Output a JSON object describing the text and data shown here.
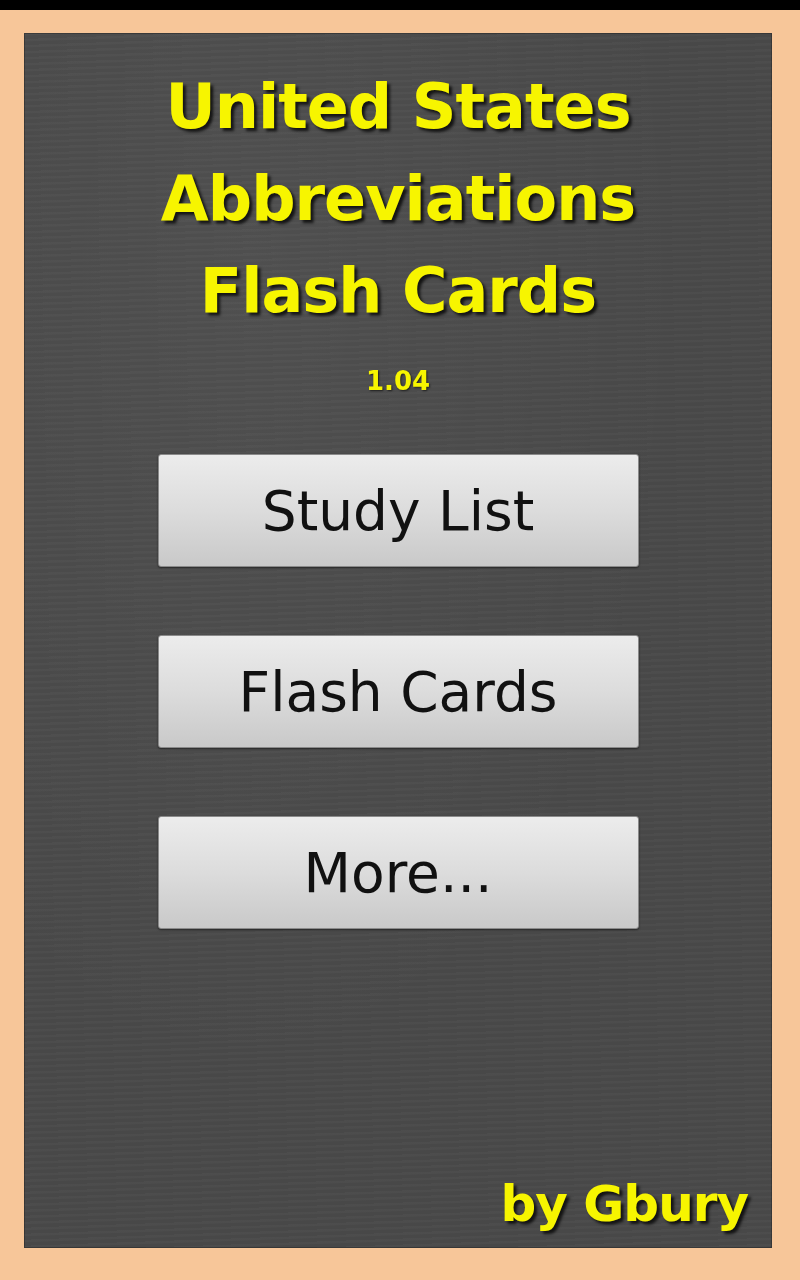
{
  "title_lines": [
    "United States",
    "Abbreviations",
    "Flash Cards"
  ],
  "version": "1.04",
  "menu_buttons": [
    {
      "label": "Study List"
    },
    {
      "label": "Flash Cards"
    },
    {
      "label": "More..."
    }
  ],
  "author": "by Gbury"
}
